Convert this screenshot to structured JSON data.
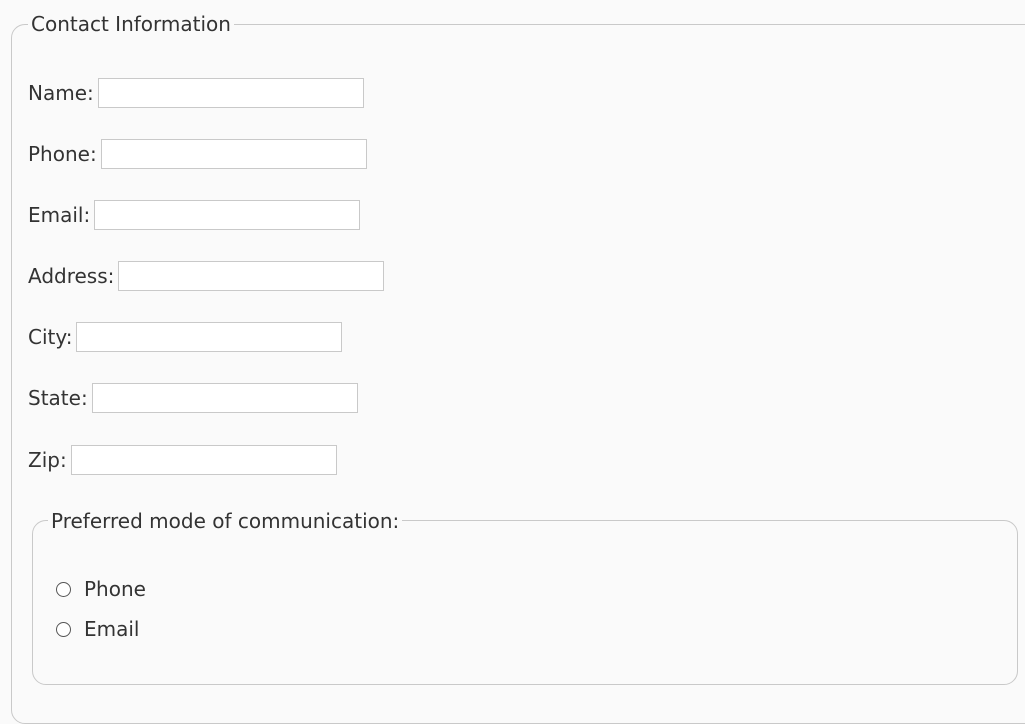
{
  "contact": {
    "legend": "Contact Information",
    "fields": [
      {
        "label": "Name:",
        "value": "",
        "placeholder": ""
      },
      {
        "label": "Phone:",
        "value": "",
        "placeholder": ""
      },
      {
        "label": "Email:",
        "value": "",
        "placeholder": ""
      },
      {
        "label": "Address:",
        "value": "",
        "placeholder": ""
      },
      {
        "label": "City:",
        "value": "",
        "placeholder": ""
      },
      {
        "label": "State:",
        "value": "",
        "placeholder": ""
      },
      {
        "label": "Zip:",
        "value": "",
        "placeholder": ""
      }
    ]
  },
  "communication": {
    "legend": "Preferred mode of communication:",
    "options": [
      {
        "label": "Phone",
        "checked": false
      },
      {
        "label": "Email",
        "checked": false
      }
    ]
  }
}
